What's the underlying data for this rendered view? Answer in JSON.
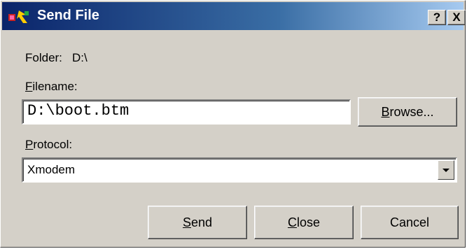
{
  "window": {
    "title": "Send File",
    "help_button": "?",
    "close_button": "X"
  },
  "folder": {
    "label": "Folder:",
    "value": "D:\\"
  },
  "filename": {
    "label_mnemonic": "F",
    "label_rest": "ilename:",
    "value": "D:\\boot.btm",
    "browse_mnemonic": "B",
    "browse_rest": "rowse..."
  },
  "protocol": {
    "label_mnemonic": "P",
    "label_rest": "rotocol:",
    "selected": "Xmodem"
  },
  "buttons": {
    "send_mnemonic": "S",
    "send_rest": "end",
    "close_mnemonic": "C",
    "close_rest": "lose",
    "cancel": "Cancel"
  },
  "colors": {
    "face": "#d4d0c8",
    "title_start": "#0a246a",
    "title_end": "#a6caf0"
  },
  "icons": {
    "app": "app-icon",
    "dropdown": "chevron-down-icon"
  }
}
